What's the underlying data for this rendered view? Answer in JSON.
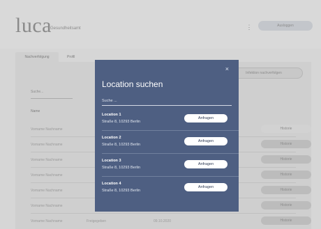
{
  "header": {
    "logo": "luca",
    "subtitle": "Gesundheitsamt",
    "menu_icon": "⋮",
    "logout_label": "Ausloggen"
  },
  "tabs": [
    {
      "label": "Nachverfolgung"
    },
    {
      "label": "Profil"
    }
  ],
  "panel": {
    "search_placeholder": "Suche...",
    "infection_button": "Infektion nachverfolgen",
    "column_name": "Name",
    "rows": [
      {
        "name": "Vorname Nachname",
        "status": "",
        "date": "",
        "button": "Historie"
      },
      {
        "name": "Vorname Nachname",
        "status": "",
        "date": "",
        "button": "Historie"
      },
      {
        "name": "Vorname Nachname",
        "status": "",
        "date": "",
        "button": "Historie"
      },
      {
        "name": "Vorname Nachname",
        "status": "",
        "date": "",
        "button": "Historie"
      },
      {
        "name": "Vorname Nachname",
        "status": "",
        "date": "",
        "button": "Historie"
      },
      {
        "name": "Vorname Nachname",
        "status": "",
        "date": "",
        "button": "Historie"
      },
      {
        "name": "Vorname Nachname",
        "status": "Freigegeben",
        "date": "09.10.2020",
        "button": "Historie"
      }
    ]
  },
  "modal": {
    "close_icon": "×",
    "title": "Location suchen",
    "search_placeholder": "Suche ...",
    "locations": [
      {
        "name": "Location 1",
        "address": "Straße 8, 10293 Berlin",
        "button": "Anfragen"
      },
      {
        "name": "Location 2",
        "address": "Straße 8, 10293 Berlin",
        "button": "Anfragen"
      },
      {
        "name": "Location 3",
        "address": "Straße 8, 10293 Berlin",
        "button": "Anfragen"
      },
      {
        "name": "Location 4",
        "address": "Straße 8, 10293 Berlin",
        "button": "Anfragen"
      }
    ]
  },
  "colors": {
    "modal_bg": "#4e5f82",
    "button_bg": "#ffffff",
    "page_bg": "#d6d6d6"
  }
}
